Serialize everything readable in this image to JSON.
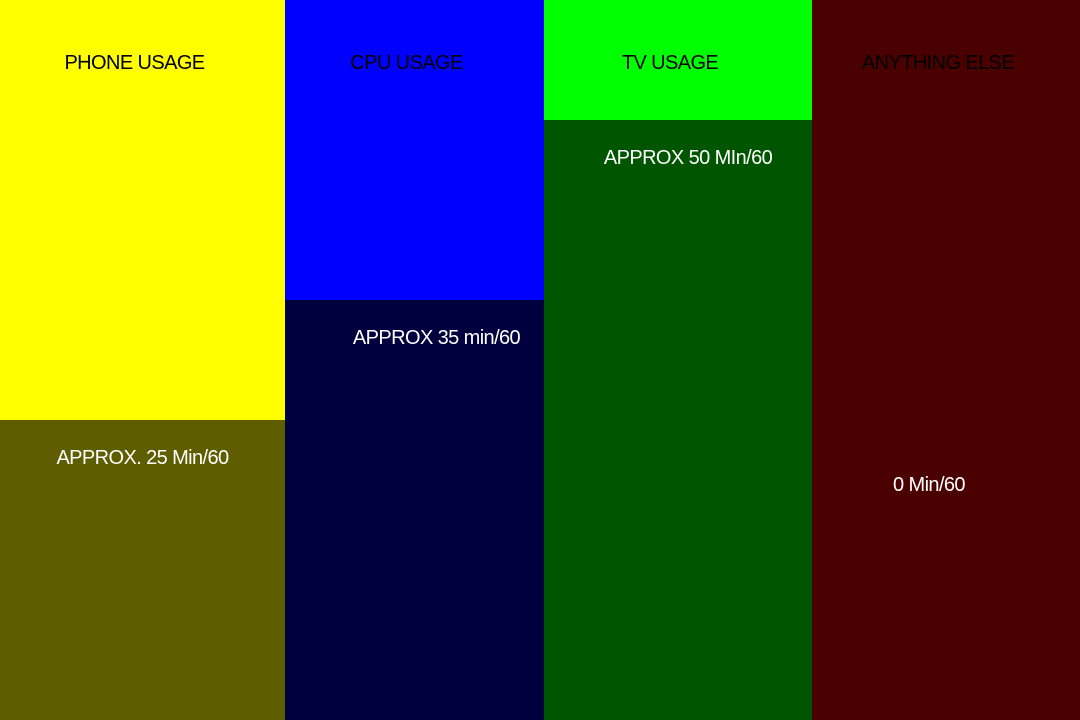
{
  "chart_data": {
    "type": "bar",
    "categories": [
      "PHONE USAGE",
      "CPU USAGE",
      "TV USAGE",
      "ANYTHING ELSE"
    ],
    "values": [
      25,
      35,
      50,
      0
    ],
    "value_labels": [
      "APPROX. 25 Min/60",
      "APPROX 35 min/60",
      "APPROX 50 MIn/60",
      "0 Min/60"
    ],
    "ylim": [
      0,
      60
    ],
    "colors": {
      "top": [
        "#FFFF00",
        "#0000FF",
        "#00FF00",
        "#4B0000"
      ],
      "fill": [
        "#5E5E00",
        "#00003F",
        "#005600",
        "#4B0000"
      ],
      "category_text": "#000000",
      "value_text": "#FFFFFF"
    }
  }
}
